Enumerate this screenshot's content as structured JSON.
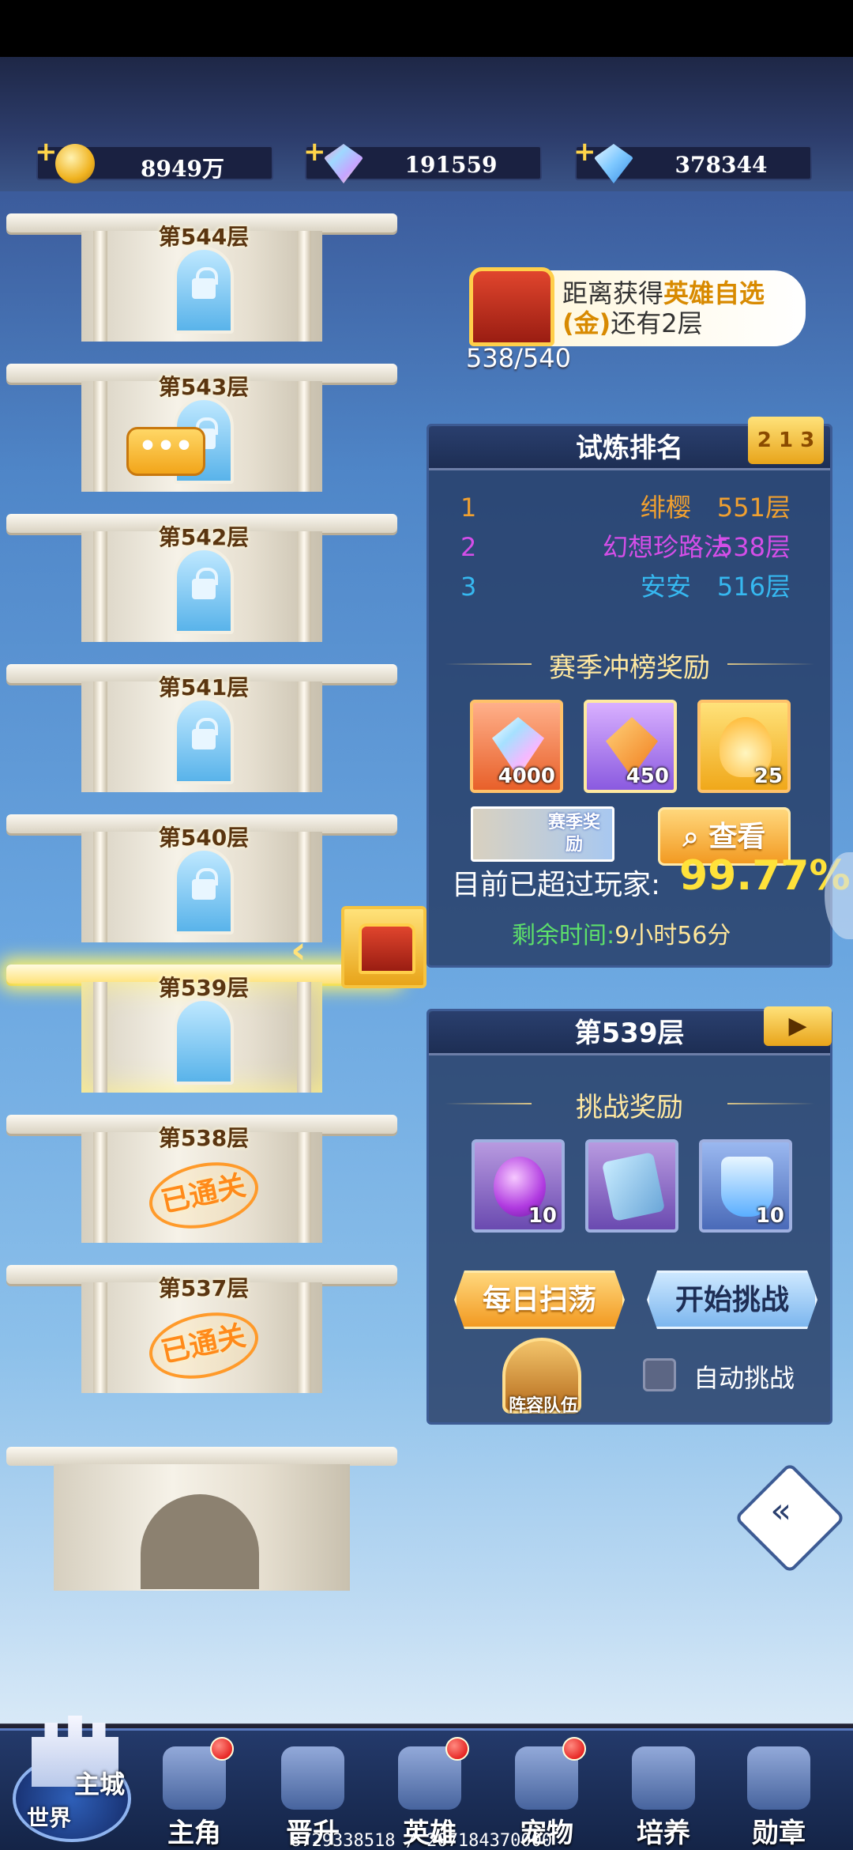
{
  "resources": [
    {
      "icon": "gold-coin-icon",
      "value": "8949万"
    },
    {
      "icon": "rainbow-diamond-icon",
      "value": "191559"
    },
    {
      "icon": "blue-diamond-icon",
      "value": "378344"
    }
  ],
  "tower": {
    "floors": [
      {
        "label": "第544层",
        "state": "locked"
      },
      {
        "label": "第543层",
        "state": "locked"
      },
      {
        "label": "第542层",
        "state": "locked"
      },
      {
        "label": "第541层",
        "state": "locked"
      },
      {
        "label": "第540层",
        "state": "locked"
      },
      {
        "label": "第539层",
        "state": "current"
      },
      {
        "label": "第538层",
        "state": "cleared"
      },
      {
        "label": "第537层",
        "state": "cleared"
      }
    ],
    "cleared_stamp": "已通关",
    "chat_bubble": "•••"
  },
  "goal": {
    "text_before": "距离获得",
    "highlight": "英雄自选(金)",
    "text_after": "还有2层",
    "progress": "538/540"
  },
  "ranking": {
    "title": "试炼排名",
    "rows": [
      {
        "rank": "1",
        "name": "绯樱",
        "floor": "551层",
        "color": "#f0a030"
      },
      {
        "rank": "2",
        "name": "幻想珍路法",
        "floor": "538层",
        "color": "#d44ee8"
      },
      {
        "rank": "3",
        "name": "安安",
        "floor": "516层",
        "color": "#36b8f0"
      }
    ],
    "season_reward_title": "赛季冲榜奖励",
    "season_rewards": [
      {
        "icon": "rainbow-diamond-icon",
        "count": "4000"
      },
      {
        "icon": "orange-crystal-icon",
        "count": "450"
      },
      {
        "icon": "golden-flame-icon",
        "count": "25"
      }
    ],
    "season_thumb_label": "赛季奖励",
    "view_button": "查看",
    "exceed_label": "目前已超过玩家:",
    "exceed_value": "99.77%",
    "remain_label": "剩余时间:",
    "remain_value": "9小时56分"
  },
  "challenge": {
    "title": "第539层",
    "reward_title": "挑战奖励",
    "rewards": [
      {
        "icon": "purple-orb-icon",
        "count": "10"
      },
      {
        "icon": "card-icon",
        "count": ""
      },
      {
        "icon": "potion-icon",
        "count": "10"
      }
    ],
    "sweep_button": "每日扫荡",
    "start_button": "开始挑战",
    "lineup_label": "阵容队伍",
    "auto_label": "自动挑战"
  },
  "nav": {
    "home_main": "主城",
    "home_sub": "世界",
    "items": [
      {
        "label": "主角",
        "dot": true
      },
      {
        "label": "晋升",
        "dot": false
      },
      {
        "label": "英雄",
        "dot": true
      },
      {
        "label": "宠物",
        "dot": true
      },
      {
        "label": "培养",
        "dot": false
      },
      {
        "label": "勋章",
        "dot": false
      }
    ]
  },
  "debug_text": "8729338518 / 207184370000"
}
